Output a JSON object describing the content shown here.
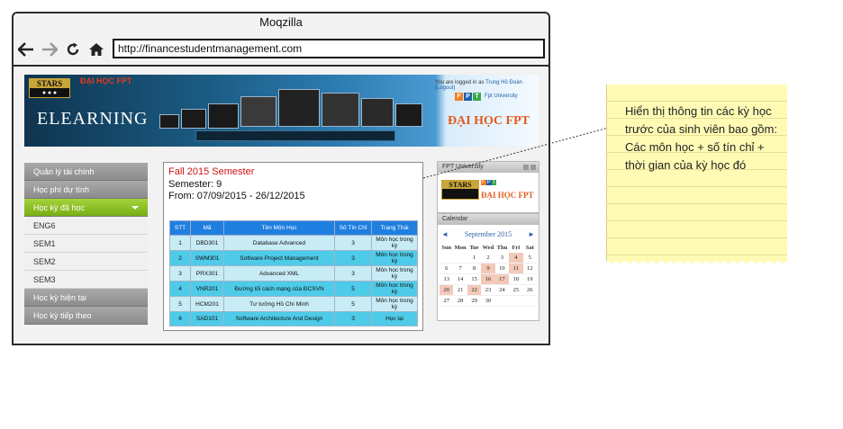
{
  "browser": {
    "title": "Moqzilla",
    "url": "http://financestudentmanagement.com"
  },
  "banner": {
    "stars_logo": "STARS",
    "fpt_small": "ĐẠI HỌC FPT",
    "elearning": "ELEARNING",
    "logged_in_prefix": "You are logged in as",
    "logged_in_user": "Trung Hồ Đoàn (Logout)",
    "fpt_university": "Fpt University",
    "dai_hoc_fpt": "ĐẠI HỌC FPT"
  },
  "sidebar": {
    "items": [
      {
        "label": "Quản lý tài chính"
      },
      {
        "label": "Học phí dự tính"
      },
      {
        "label": "Học kỳ đã học"
      },
      {
        "label": "ENG6"
      },
      {
        "label": "SEM1"
      },
      {
        "label": "SEM2"
      },
      {
        "label": "SEM3"
      },
      {
        "label": "Học kỳ hiện tại"
      },
      {
        "label": "Học kỳ tiếp theo"
      }
    ]
  },
  "semester": {
    "title": "Fall 2015 Semester",
    "number": "Semester: 9",
    "period": "From: 07/09/2015 - 26/12/2015"
  },
  "table": {
    "headers": [
      "STT",
      "Mã",
      "Tên Môn Học",
      "Số Tín Chỉ",
      "Trạng Thái"
    ],
    "rows": [
      [
        "1",
        "DBD301",
        "Database Advanced",
        "3",
        "Môn học trong kỳ"
      ],
      [
        "2",
        "SWM301",
        "Software Project Management",
        "3",
        "Môn học trong kỳ"
      ],
      [
        "3",
        "PRX301",
        "Advanced XML",
        "3",
        "Môn học trong kỳ"
      ],
      [
        "4",
        "VNR201",
        "Đường lối cách mạng của ĐCSVN",
        "5",
        "Môn học trong kỳ"
      ],
      [
        "5",
        "HCM201",
        "Tư tưởng Hồ Chí Minh",
        "5",
        "Môn học trong kỳ"
      ],
      [
        "6",
        "SAD101",
        "Software Architecture And Design",
        "3",
        "Học lại"
      ]
    ]
  },
  "right": {
    "fpt_box_title": "FPT University",
    "stars_logo": "STARS",
    "dai_hoc_fpt": "ĐẠI HỌC FPT",
    "calendar_title": "Calendar",
    "month": "September 2015",
    "prev": "◄",
    "next": "►",
    "dow": [
      "Sun",
      "Mon",
      "Tue",
      "Wed",
      "Thu",
      "Fri",
      "Sat"
    ],
    "days": [
      "",
      "",
      "1",
      "2",
      "3",
      "4",
      "5",
      "6",
      "7",
      "8",
      "9",
      "10",
      "11",
      "12",
      "13",
      "14",
      "15",
      "16",
      "17",
      "18",
      "19",
      "20",
      "21",
      "22",
      "23",
      "24",
      "25",
      "26",
      "27",
      "28",
      "29",
      "30",
      "",
      "",
      ""
    ],
    "highlighted_days": [
      "4",
      "9",
      "11",
      "16",
      "17",
      "20",
      "22"
    ]
  },
  "sticky_note": {
    "text": "Hiển thị thông tin các kỳ học trước của sinh viên bao gồm: Các môn học + số tín chỉ + thời gian của kỳ học đó"
  },
  "colors": {
    "active_menu": "#8cc21f",
    "semester_title": "#d31212",
    "table_header": "#1f7fe0",
    "sticky": "#fffbb5"
  }
}
